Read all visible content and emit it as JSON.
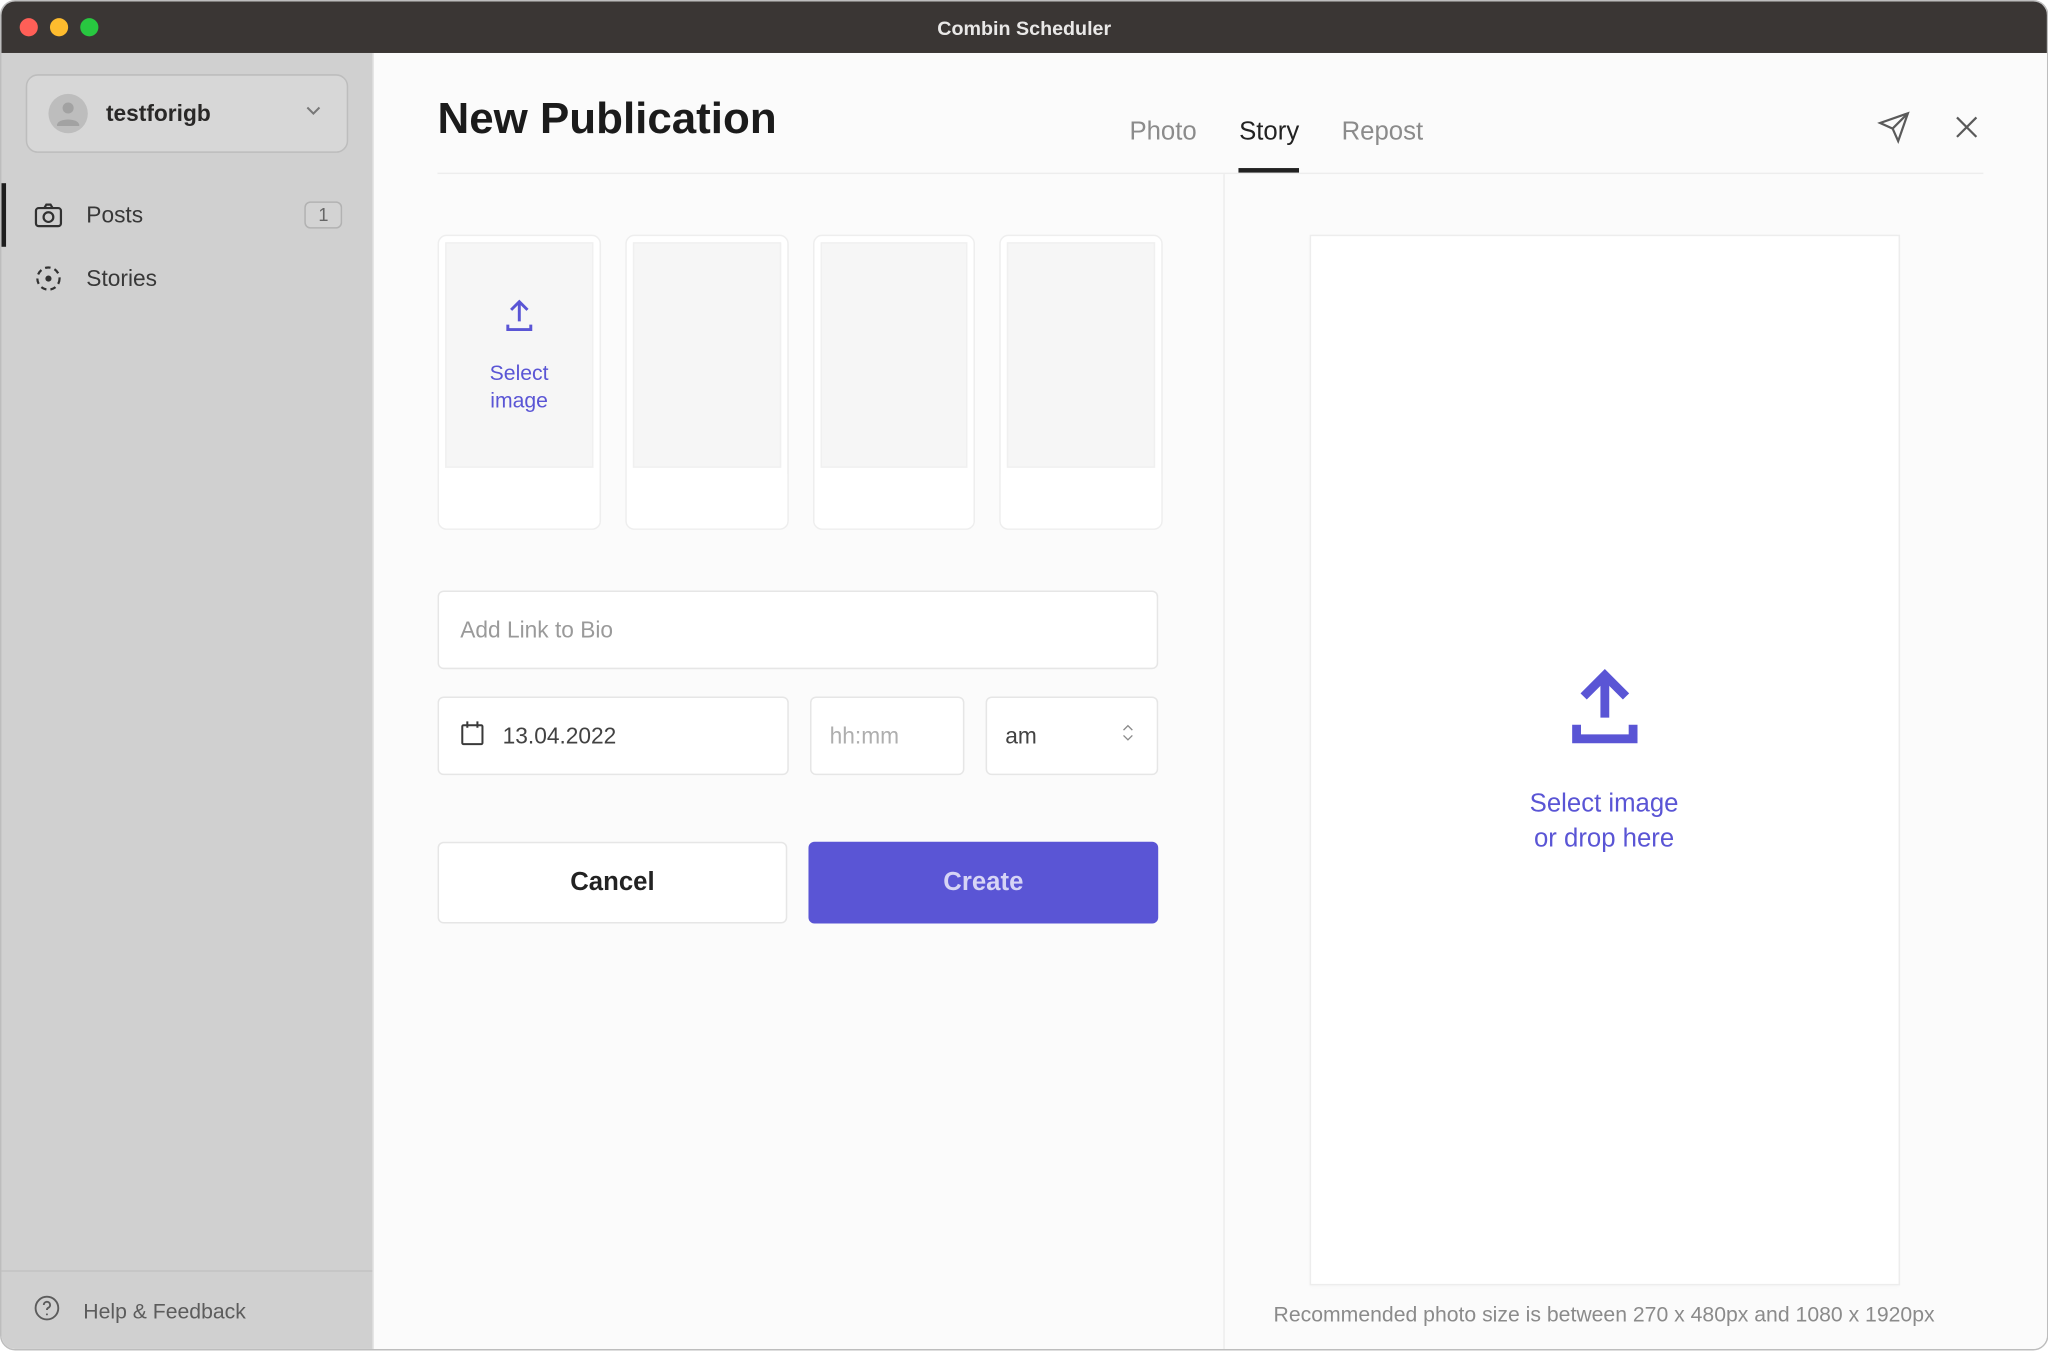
{
  "window": {
    "title": "Combin Scheduler"
  },
  "sidebar": {
    "account": {
      "name": "testforigb"
    },
    "nav": {
      "posts": {
        "label": "Posts",
        "count": "1"
      },
      "stories": {
        "label": "Stories"
      }
    },
    "footer": {
      "label": "Help & Feedback"
    }
  },
  "main": {
    "title": "New Publication",
    "tabs": {
      "photo": "Photo",
      "story": "Story",
      "repost": "Repost",
      "active": "Story"
    }
  },
  "form": {
    "select_image": {
      "line1": "Select",
      "line2": "image"
    },
    "link_placeholder": "Add Link to Bio",
    "date_value": "13.04.2022",
    "time_placeholder": "hh:mm",
    "ampm": "am",
    "cancel": "Cancel",
    "create": "Create"
  },
  "preview": {
    "line1": "Select image",
    "line2": "or drop here",
    "recommended": "Recommended photo size is between 270 x 480px and 1080 x 1920px"
  }
}
